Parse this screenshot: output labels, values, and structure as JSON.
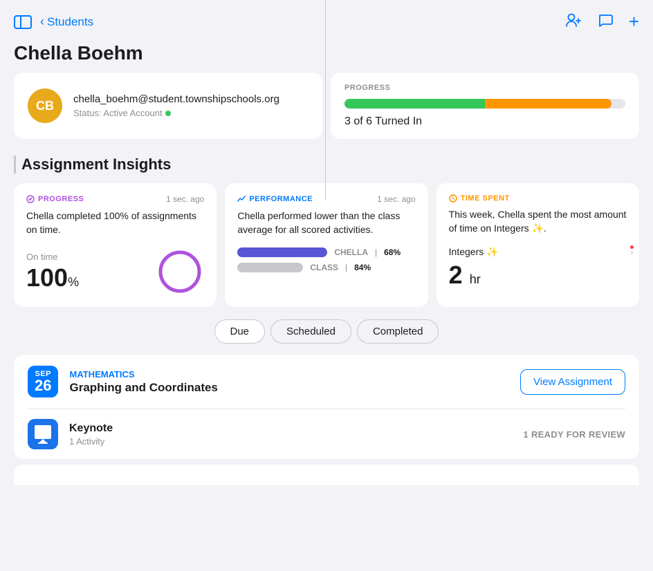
{
  "nav": {
    "back_label": "Students",
    "page_title": "Chella Boehm"
  },
  "icons": {
    "person_plus": "👤",
    "chat": "💬",
    "plus": "+"
  },
  "profile": {
    "initials": "CB",
    "email": "chella_boehm@student.townshipschools.org",
    "status": "Status: Active Account"
  },
  "progress_card": {
    "label": "PROGRESS",
    "green_pct": 50,
    "orange_pct": 45,
    "summary": "3 of 6 Turned In"
  },
  "section": {
    "title": "Assignment Insights"
  },
  "insight_progress": {
    "badge": "PROGRESS",
    "timestamp": "1 sec. ago",
    "description": "Chella completed 100% of assignments on time.",
    "on_time_label": "On time",
    "on_time_value": "100",
    "on_time_unit": "%"
  },
  "insight_performance": {
    "badge": "PERFORMANCE",
    "timestamp": "1 sec. ago",
    "description": "Chella performed lower than the class average for all scored activities.",
    "chella_label": "CHELLA",
    "chella_pct": "68%",
    "class_label": "CLASS",
    "class_pct": "84%"
  },
  "insight_time": {
    "badge": "TIME SPENT",
    "description": "This week, Chella spent the most amount of time on Integers ✨.",
    "topic": "Integers ✨",
    "value": "2",
    "unit": "hr"
  },
  "filters": [
    {
      "label": "Due",
      "active": true
    },
    {
      "label": "Scheduled",
      "active": false
    },
    {
      "label": "Completed",
      "active": false
    }
  ],
  "assignment": {
    "date_month": "SEP",
    "date_day": "26",
    "subject": "MATHEMATICS",
    "title": "Graphing and Coordinates",
    "view_btn": "View Assignment",
    "activity_icon_label": "K",
    "activity_name": "Keynote",
    "activity_count": "1 Activity",
    "activity_status": "1 READY FOR REVIEW"
  }
}
